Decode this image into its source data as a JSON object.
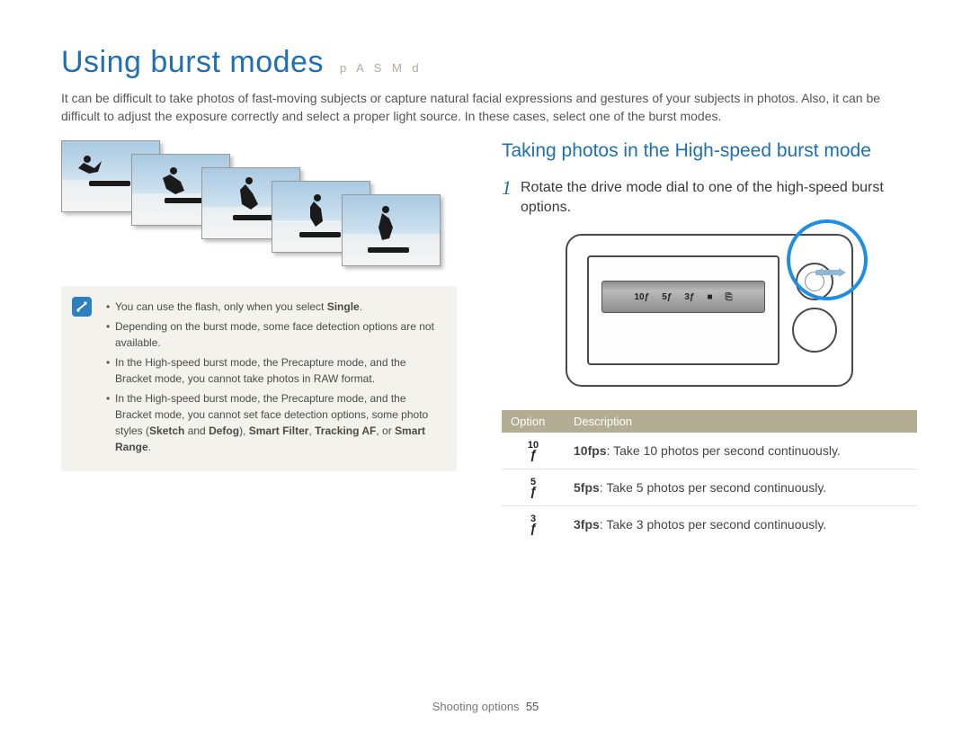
{
  "header": {
    "title": "Using burst modes",
    "mode_letters": "p A S M d"
  },
  "intro": "It can be difficult to take photos of fast-moving subjects or capture natural facial expressions and gestures of your subjects in photos. Also, it can be difficult to adjust the exposure correctly and select a proper light source. In these cases, select one of the burst modes.",
  "notes": {
    "n1_a": "You can use the flash, only when you select ",
    "n1_b": "Single",
    "n1_c": ".",
    "n2": "Depending on the burst mode, some face detection options are not available.",
    "n3": "In the High-speed burst mode, the Precapture mode, and the Bracket mode, you cannot take photos in RAW format.",
    "n4_a": "In the High-speed burst mode, the Precapture mode, and the Bracket mode, you cannot set face detection options, some photo styles (",
    "n4_b": "Sketch",
    "n4_c": " and ",
    "n4_d": "Defog",
    "n4_e": "), ",
    "n4_f": "Smart Filter",
    "n4_g": ", ",
    "n4_h": "Tracking AF",
    "n4_i": ", or ",
    "n4_j": "Smart Range",
    "n4_k": "."
  },
  "section": {
    "title": "Taking photos in the High-speed burst mode",
    "step_num": "1",
    "step_text": "Rotate the drive mode dial to one of the high-speed burst options."
  },
  "mode_icons": {
    "a": "10",
    "b": "5",
    "c": "3",
    "d": "■",
    "e": "⎘"
  },
  "table": {
    "h1": "Option",
    "h2": "Description",
    "rows": {
      "r1": {
        "icon_top": "10",
        "bold": "10fps",
        "rest": ": Take 10 photos per second continuously."
      },
      "r2": {
        "icon_top": "5",
        "bold": "5fps",
        "rest": ": Take 5 photos per second continuously."
      },
      "r3": {
        "icon_top": "3",
        "bold": "3fps",
        "rest": ": Take 3 photos per second continuously."
      }
    }
  },
  "footer": {
    "label": "Shooting options",
    "page": "55"
  }
}
